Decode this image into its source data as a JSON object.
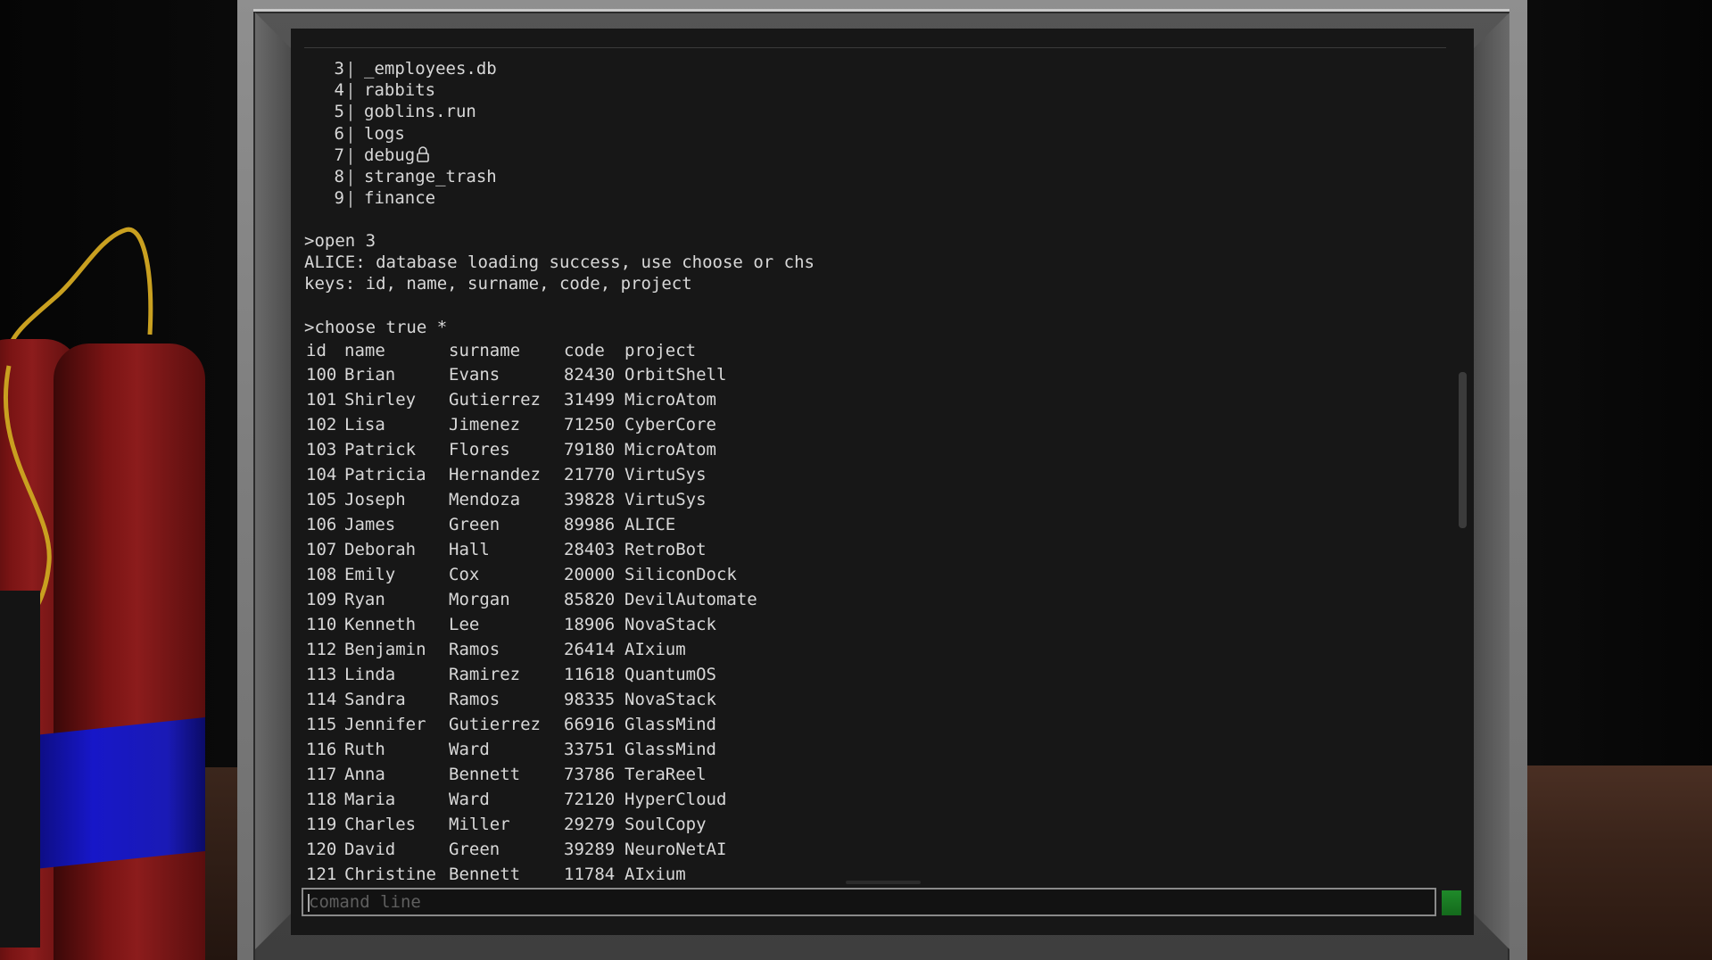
{
  "window": {
    "scene": "terminal-monitor"
  },
  "file_list": [
    {
      "num": "3",
      "name": "_employees.db"
    },
    {
      "num": "4",
      "name": "rabbits"
    },
    {
      "num": "5",
      "name": "goblins.run"
    },
    {
      "num": "6",
      "name": "logs"
    },
    {
      "num": "7",
      "name": "debug",
      "icon": "lock-icon"
    },
    {
      "num": "8",
      "name": "strange_trash"
    },
    {
      "num": "9",
      "name": "finance"
    }
  ],
  "log": {
    "cmd1": ">open 3",
    "msg1": "ALICE: database loading success, use choose or chs",
    "msg2": "keys: id, name, surname, code, project",
    "cmd2": ">choose true *"
  },
  "table": {
    "headers": [
      "id",
      "name",
      "surname",
      "code",
      "project"
    ],
    "rows": [
      [
        "100",
        "Brian",
        "Evans",
        "82430",
        "OrbitShell"
      ],
      [
        "101",
        "Shirley",
        "Gutierrez",
        "31499",
        "MicroAtom"
      ],
      [
        "102",
        "Lisa",
        "Jimenez",
        "71250",
        "CyberCore"
      ],
      [
        "103",
        "Patrick",
        "Flores",
        "79180",
        "MicroAtom"
      ],
      [
        "104",
        "Patricia",
        "Hernandez",
        "21770",
        "VirtuSys"
      ],
      [
        "105",
        "Joseph",
        "Mendoza",
        "39828",
        "VirtuSys"
      ],
      [
        "106",
        "James",
        "Green",
        "89986",
        "ALICE"
      ],
      [
        "107",
        "Deborah",
        "Hall",
        "28403",
        "RetroBot"
      ],
      [
        "108",
        "Emily",
        "Cox",
        "20000",
        "SiliconDock"
      ],
      [
        "109",
        "Ryan",
        "Morgan",
        "85820",
        "DevilAutomate"
      ],
      [
        "110",
        "Kenneth",
        "Lee",
        "18906",
        "NovaStack"
      ],
      [
        "112",
        "Benjamin",
        "Ramos",
        "26414",
        "AIxium"
      ],
      [
        "113",
        "Linda",
        "Ramirez",
        "11618",
        "QuantumOS"
      ],
      [
        "114",
        "Sandra",
        "Ramos",
        "98335",
        "NovaStack"
      ],
      [
        "115",
        "Jennifer",
        "Gutierrez",
        "66916",
        "GlassMind"
      ],
      [
        "116",
        "Ruth",
        "Ward",
        "33751",
        "GlassMind"
      ],
      [
        "117",
        "Anna",
        "Bennett",
        "73786",
        "TeraReel"
      ],
      [
        "118",
        "Maria",
        "Ward",
        "72120",
        "HyperCloud"
      ],
      [
        "119",
        "Charles",
        "Miller",
        "29279",
        "SoulCopy"
      ],
      [
        "120",
        "David",
        "Green",
        "39289",
        "NeuroNetAI"
      ],
      [
        "121",
        "Christine",
        "Bennett",
        "11784",
        "AIxium"
      ]
    ]
  },
  "command_line": {
    "placeholder": "comand line"
  },
  "colors": {
    "screen_bg": "#171717",
    "text": "#d8d8d8",
    "send_button": "#1f8a2a",
    "dynamite_red": "#8c1c1c",
    "dynamite_band": "#1717c8"
  }
}
